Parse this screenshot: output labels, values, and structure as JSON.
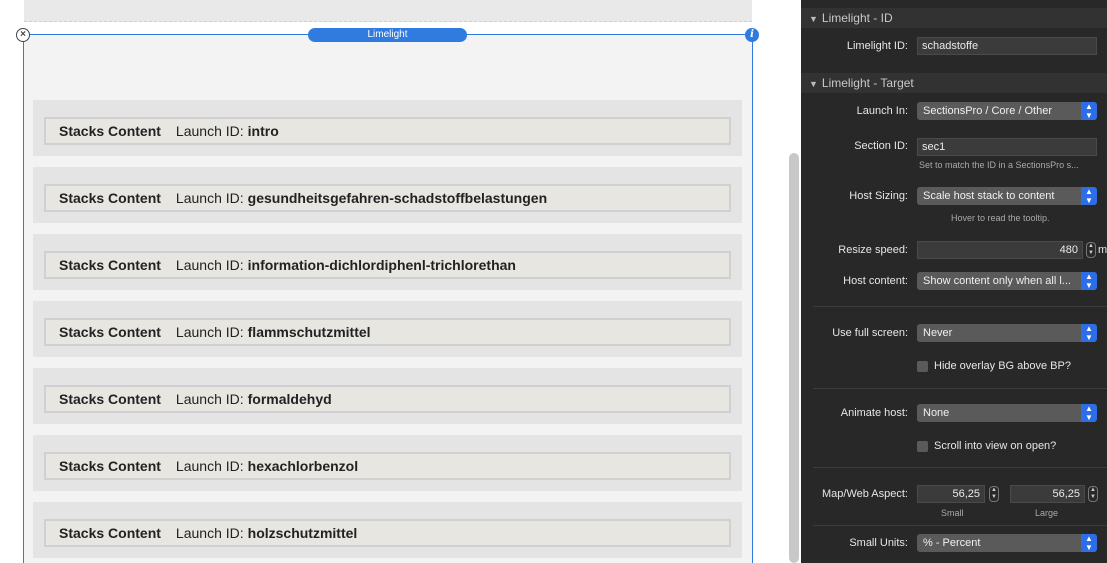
{
  "canvas": {
    "frame_label": "Limelight",
    "rows": [
      {
        "stack_label": "Stacks Content",
        "launch_label": "Launch ID:",
        "launch_id": "intro"
      },
      {
        "stack_label": "Stacks Content",
        "launch_label": "Launch ID:",
        "launch_id": "gesundheitsgefahren-schadstoffbelastungen"
      },
      {
        "stack_label": "Stacks Content",
        "launch_label": "Launch ID:",
        "launch_id": "information-dichlordiphenl-trichlorethan"
      },
      {
        "stack_label": "Stacks Content",
        "launch_label": "Launch ID:",
        "launch_id": "flammschutzmittel"
      },
      {
        "stack_label": "Stacks Content",
        "launch_label": "Launch ID:",
        "launch_id": "formaldehyd"
      },
      {
        "stack_label": "Stacks Content",
        "launch_label": "Launch ID:",
        "launch_id": "hexachlorbenzol"
      },
      {
        "stack_label": "Stacks Content",
        "launch_label": "Launch ID:",
        "launch_id": "holzschutzmittel"
      }
    ]
  },
  "inspector": {
    "section_id": {
      "title": "Limelight - ID",
      "limelight_id_label": "Limelight ID:",
      "limelight_id_value": "schadstoffe"
    },
    "section_target": {
      "title": "Limelight - Target",
      "launch_in_label": "Launch In:",
      "launch_in_value": "SectionsPro / Core / Other",
      "section_id_label": "Section ID:",
      "section_id_value": "sec1",
      "section_id_hint": "Set to match the ID in a SectionsPro s...",
      "host_sizing_label": "Host Sizing:",
      "host_sizing_value": "Scale host stack to content",
      "host_sizing_hint": "Hover to read the tooltip.",
      "resize_speed_label": "Resize speed:",
      "resize_speed_value": "480",
      "resize_speed_unit": "m",
      "host_content_label": "Host content:",
      "host_content_value": "Show content only when all l...",
      "full_screen_label": "Use full screen:",
      "full_screen_value": "Never",
      "hide_overlay_label": "Hide overlay BG above BP?",
      "animate_host_label": "Animate host:",
      "animate_host_value": "None",
      "scroll_into_view_label": "Scroll into view on open?",
      "map_aspect_label": "Map/Web Aspect:",
      "map_aspect_small": "56,25",
      "map_aspect_large": "56,25",
      "small_caption": "Small",
      "large_caption": "Large",
      "small_units_label": "Small Units:",
      "small_units_value": "% - Percent"
    }
  },
  "colors": {
    "accent": "#2f7be0",
    "inspector_bg": "#282828",
    "select_arrow": "#2d6ee8"
  }
}
